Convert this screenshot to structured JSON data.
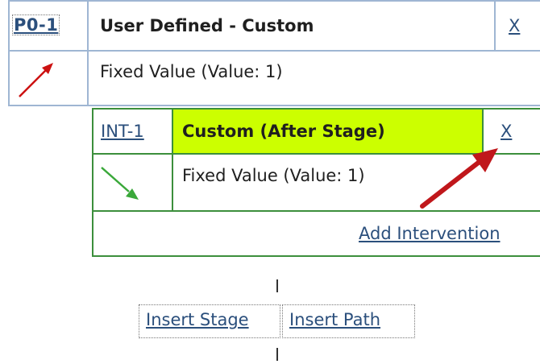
{
  "outer_stage": {
    "id_link": "P0-1",
    "title": "User Defined - Custom",
    "close_label": "X",
    "value_text": "Fixed Value (Value: 1)",
    "trend_icon": "arrow-up-right-icon",
    "trend_color": "#cc1111"
  },
  "intervention": {
    "id_link": "INT-1",
    "title": "Custom (After Stage)",
    "close_label": "X",
    "value_text": "Fixed Value (Value: 1)",
    "trend_icon": "arrow-down-right-icon",
    "trend_color": "#3aa83a",
    "header_highlight": "#ccff00",
    "add_link": "Add Intervention"
  },
  "actions": {
    "insert_stage": "Insert Stage",
    "insert_path": "Insert Path"
  },
  "annotation": {
    "pointer_icon": "red-callout-arrow-icon",
    "color": "#c0171b"
  }
}
